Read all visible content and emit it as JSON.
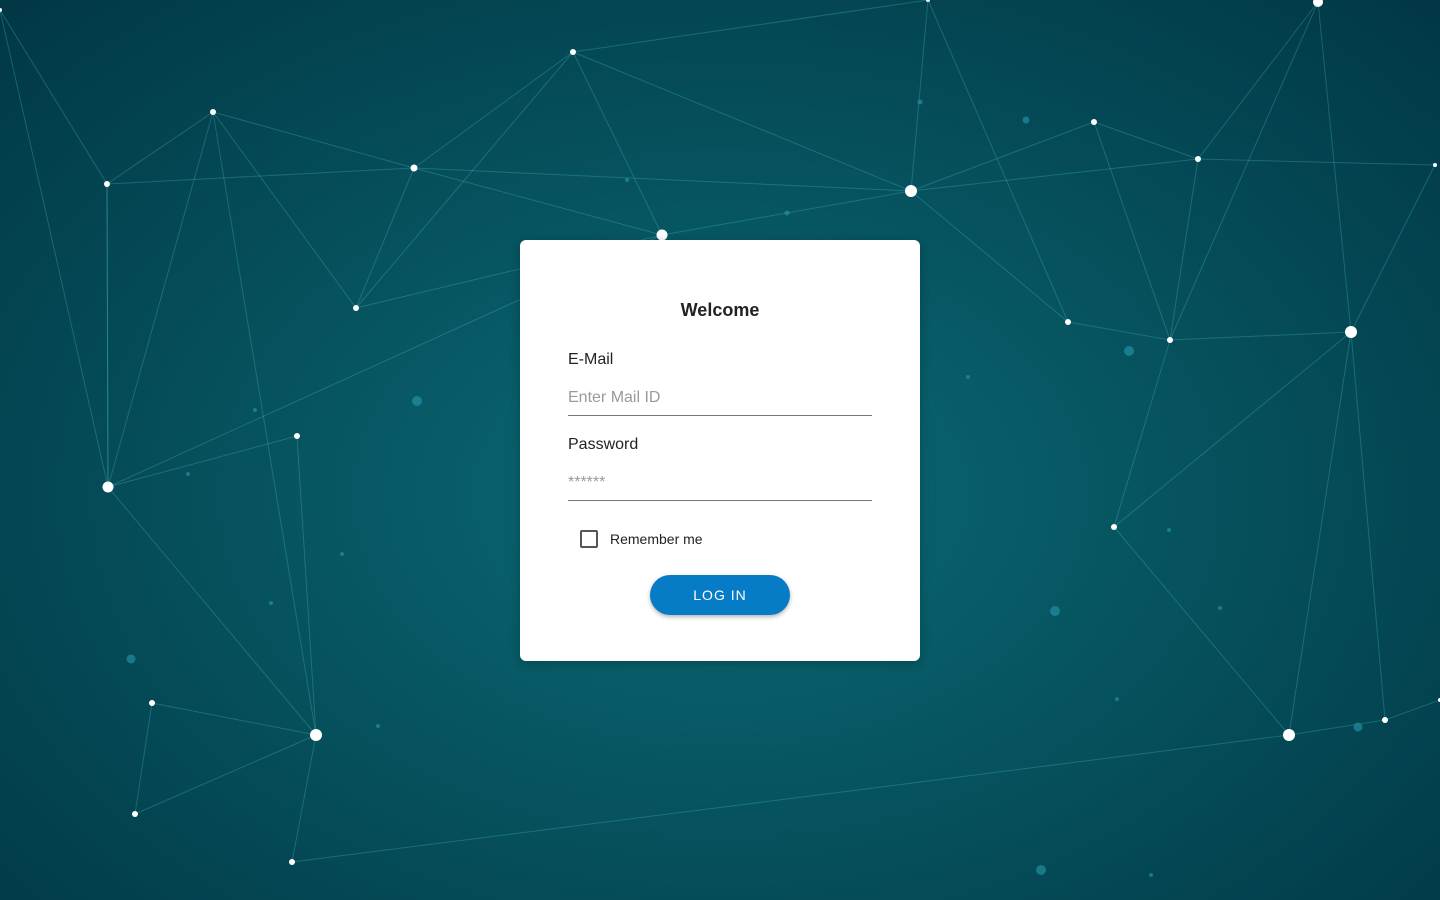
{
  "login": {
    "title": "Welcome",
    "email_label": "E-Mail",
    "email_placeholder": "Enter Mail ID",
    "email_value": "",
    "password_label": "Password",
    "password_placeholder": "******",
    "password_value": "",
    "remember_label": "Remember me",
    "remember_checked": false,
    "login_button": "LOG IN"
  },
  "colors": {
    "background": "#055a66",
    "accent": "#067bc6",
    "card": "#ffffff"
  }
}
